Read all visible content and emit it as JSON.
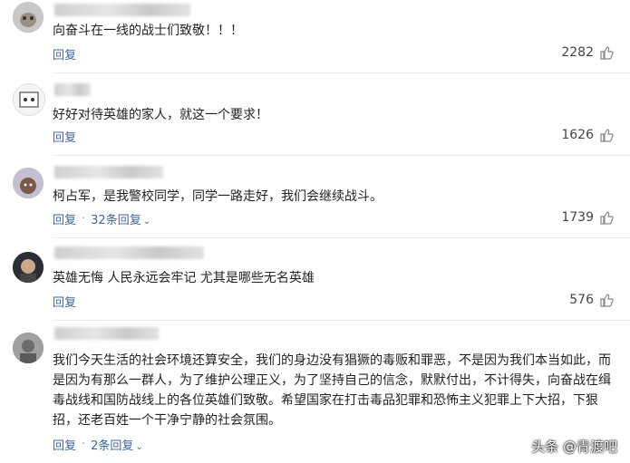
{
  "comments": [
    {
      "text": "向奋斗在一线的战士们致敬！！！",
      "reply_label": "回复",
      "replies_label": "",
      "likes": "2282"
    },
    {
      "text": "好好对待英雄的家人，就这一个要求！",
      "reply_label": "回复",
      "replies_label": "",
      "likes": "1626"
    },
    {
      "text": "柯占军，是我警校同学，同学一路走好，我们会继续战斗。",
      "reply_label": "回复",
      "replies_label": "32条回复",
      "likes": "1739"
    },
    {
      "text": "英雄无悔 人民永远会牢记 尤其是哪些无名英雄",
      "reply_label": "回复",
      "replies_label": "",
      "likes": "576"
    },
    {
      "text": "我们今天生活的社会环境还算安全，我们的身边没有猖獗的毒贩和罪恶，不是因为我们本当如此，而是因为有那么一群人，为了维护公理正义，为了坚持自己的信念，默默付出，不计得失，向奋战在缉毒战线和国防战线上的各位英雄们致敬。希望国家在打击毒品犯罪和恐怖主义犯罪上下大招，下狠招，还老百姓一个干净宁静的社会氛围。",
      "reply_label": "回复",
      "replies_label": "2条回复",
      "likes": ""
    }
  ],
  "watermark": "头条 @青渡吧",
  "colors": {
    "link": "#406599",
    "text": "#222222",
    "likes": "#444444"
  }
}
